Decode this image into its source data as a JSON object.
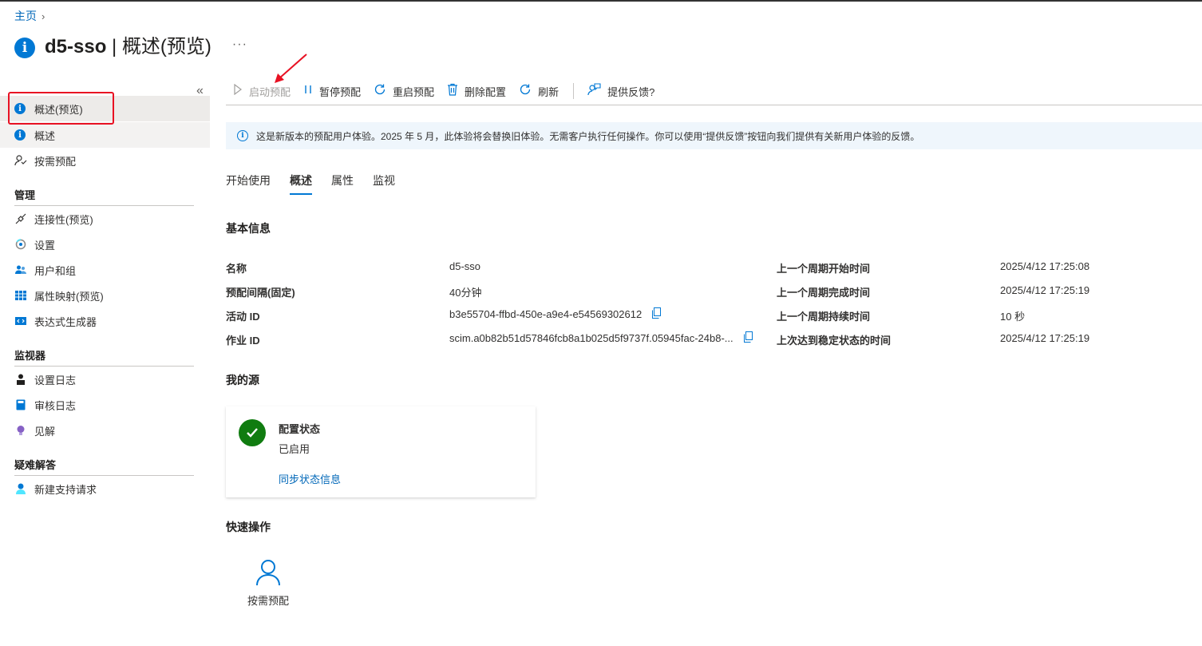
{
  "breadcrumb": {
    "home": "主页",
    "sep": "›"
  },
  "header": {
    "app_name": "d5-sso",
    "divider": " | ",
    "page_name": "概述(预览)",
    "more": "···"
  },
  "sidebar": {
    "collapse": "«",
    "items_top": [
      {
        "label": "概述(预览)",
        "icon": "info-icon"
      },
      {
        "label": "概述",
        "icon": "info-icon"
      },
      {
        "label": "按需预配",
        "icon": "provision-icon"
      }
    ],
    "sections": [
      {
        "title": "管理",
        "items": [
          {
            "label": "连接性(预览)",
            "icon": "plug-icon"
          },
          {
            "label": "设置",
            "icon": "settings-icon"
          },
          {
            "label": "用户和组",
            "icon": "users-icon"
          },
          {
            "label": "属性映射(预览)",
            "icon": "table-icon"
          },
          {
            "label": "表达式生成器",
            "icon": "code-icon"
          }
        ]
      },
      {
        "title": "监视器",
        "items": [
          {
            "label": "设置日志",
            "icon": "person-log-icon"
          },
          {
            "label": "审核日志",
            "icon": "book-icon"
          },
          {
            "label": "见解",
            "icon": "lightbulb-icon"
          }
        ]
      },
      {
        "title": "疑难解答",
        "items": [
          {
            "label": "新建支持请求",
            "icon": "support-icon"
          }
        ]
      }
    ]
  },
  "toolbar": {
    "start": "启动预配",
    "pause": "暂停预配",
    "restart": "重启预配",
    "delete": "删除配置",
    "refresh": "刷新",
    "feedback": "提供反馈?"
  },
  "infobar": {
    "text": "这是新版本的预配用户体验。2025 年 5 月，此体验将会替换旧体验。无需客户执行任何操作。你可以使用“提供反馈”按钮向我们提供有关新用户体验的反馈。"
  },
  "tabs": [
    "开始使用",
    "概述",
    "属性",
    "监视"
  ],
  "basic_info": {
    "title": "基本信息",
    "left": [
      {
        "label": "名称",
        "value": "d5-sso"
      },
      {
        "label": "预配间隔(固定)",
        "value": "40分钟"
      },
      {
        "label": "活动 ID",
        "value": "b3e55704-ffbd-450e-a9e4-e54569302612"
      },
      {
        "label": "作业 ID",
        "value": "scim.a0b82b51d57846fcb8a1b025d5f9737f.05945fac-24b8-..."
      }
    ],
    "right": [
      {
        "label": "上一个周期开始时间",
        "value": "2025/4/12 17:25:08"
      },
      {
        "label": "上一个周期完成时间",
        "value": "2025/4/12 17:25:19"
      },
      {
        "label": "上一个周期持续时间",
        "value": "10 秒"
      },
      {
        "label": "上次达到稳定状态的时间",
        "value": "2025/4/12 17:25:19"
      }
    ]
  },
  "my_source": {
    "title": "我的源",
    "card": {
      "title": "配置状态",
      "value": "已启用",
      "link": "同步状态信息"
    }
  },
  "quick_actions": {
    "title": "快速操作",
    "items": [
      {
        "label": "按需预配",
        "icon": "person-icon"
      }
    ]
  },
  "colors": {
    "accent": "#0078d4",
    "success": "#107c10",
    "highlight": "#e81123"
  }
}
